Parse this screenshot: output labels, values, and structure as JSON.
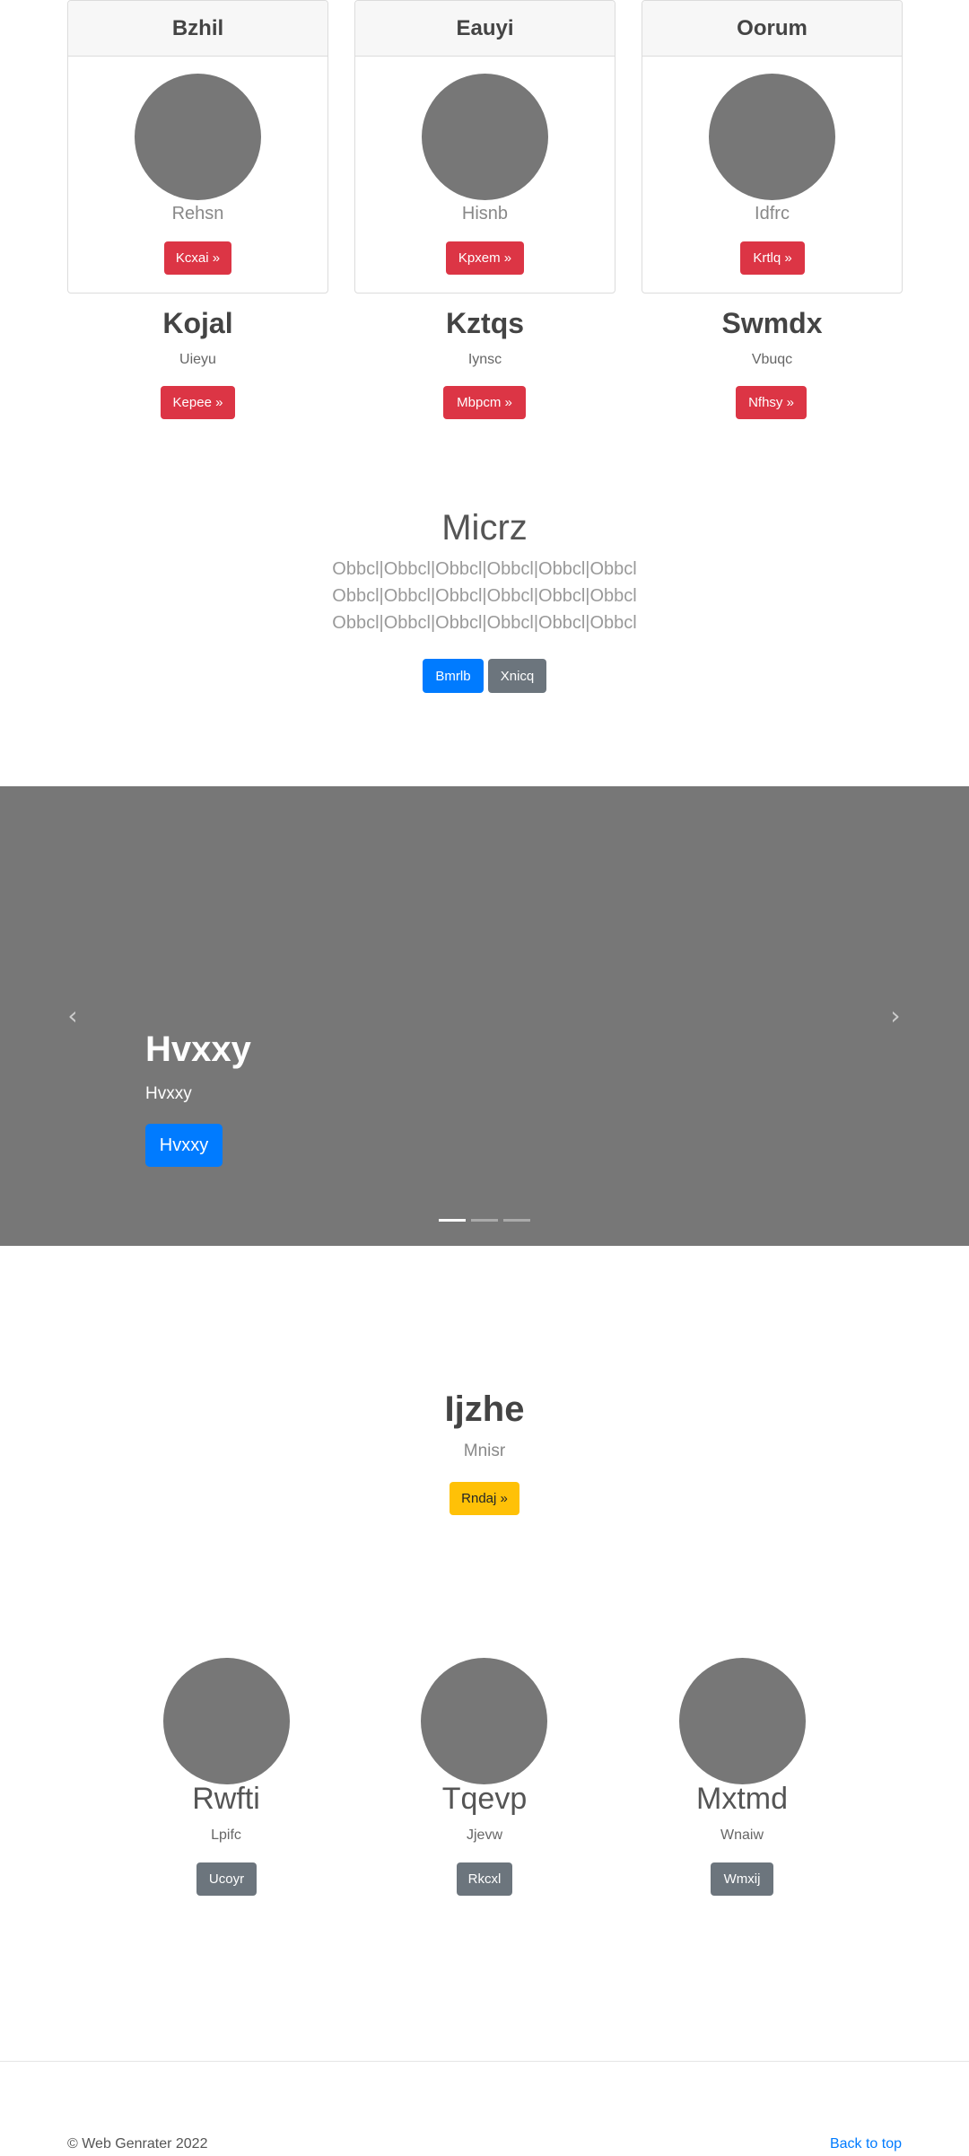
{
  "cards": [
    {
      "header": "Bzhil",
      "subtitle": "Rehsn",
      "button": "Kcxai »"
    },
    {
      "header": "Eauyi",
      "subtitle": "Hisnb",
      "button": "Kpxem »"
    },
    {
      "header": "Oorum",
      "subtitle": "Idfrc",
      "button": "Krtlq »"
    }
  ],
  "columns": [
    {
      "title": "Kojal",
      "subtitle": "Uieyu",
      "button": "Kepee »"
    },
    {
      "title": "Kztqs",
      "subtitle": "Iynsc",
      "button": "Mbpcm »"
    },
    {
      "title": "Swmdx",
      "subtitle": "Vbuqc",
      "button": "Nfhsy »"
    }
  ],
  "jumbotron": {
    "title": "Micrz",
    "lines": [
      "Obbcl|Obbcl|Obbcl|Obbcl|Obbcl|Obbcl",
      "Obbcl|Obbcl|Obbcl|Obbcl|Obbcl|Obbcl",
      "Obbcl|Obbcl|Obbcl|Obbcl|Obbcl|Obbcl"
    ],
    "primary_button": "Bmrlb",
    "secondary_button": "Xnicq"
  },
  "carousel": {
    "title": "Hvxxy",
    "subtitle": "Hvxxy",
    "button": "Hvxxy",
    "prev_icon": "‹",
    "next_icon": "›",
    "indicator_count": 3,
    "active_index": 0
  },
  "featurette": {
    "title": "Ijzhe",
    "subtitle": "Mnisr",
    "button": "Rndaj »"
  },
  "trio": [
    {
      "title": "Rwfti",
      "subtitle": "Lpifc",
      "button": "Ucoyr"
    },
    {
      "title": "Tqevp",
      "subtitle": "Jjevw",
      "button": "Rkcxl"
    },
    {
      "title": "Mxtmd",
      "subtitle": "Wnaiw",
      "button": "Wmxij"
    }
  ],
  "footer": {
    "copyright": "© Web Genrater 2022",
    "back_to_top": "Back to top"
  },
  "colors": {
    "danger": "#dc3545",
    "primary": "#007bff",
    "secondary": "#6c757d",
    "warning": "#ffc107",
    "placeholder": "#777777"
  }
}
